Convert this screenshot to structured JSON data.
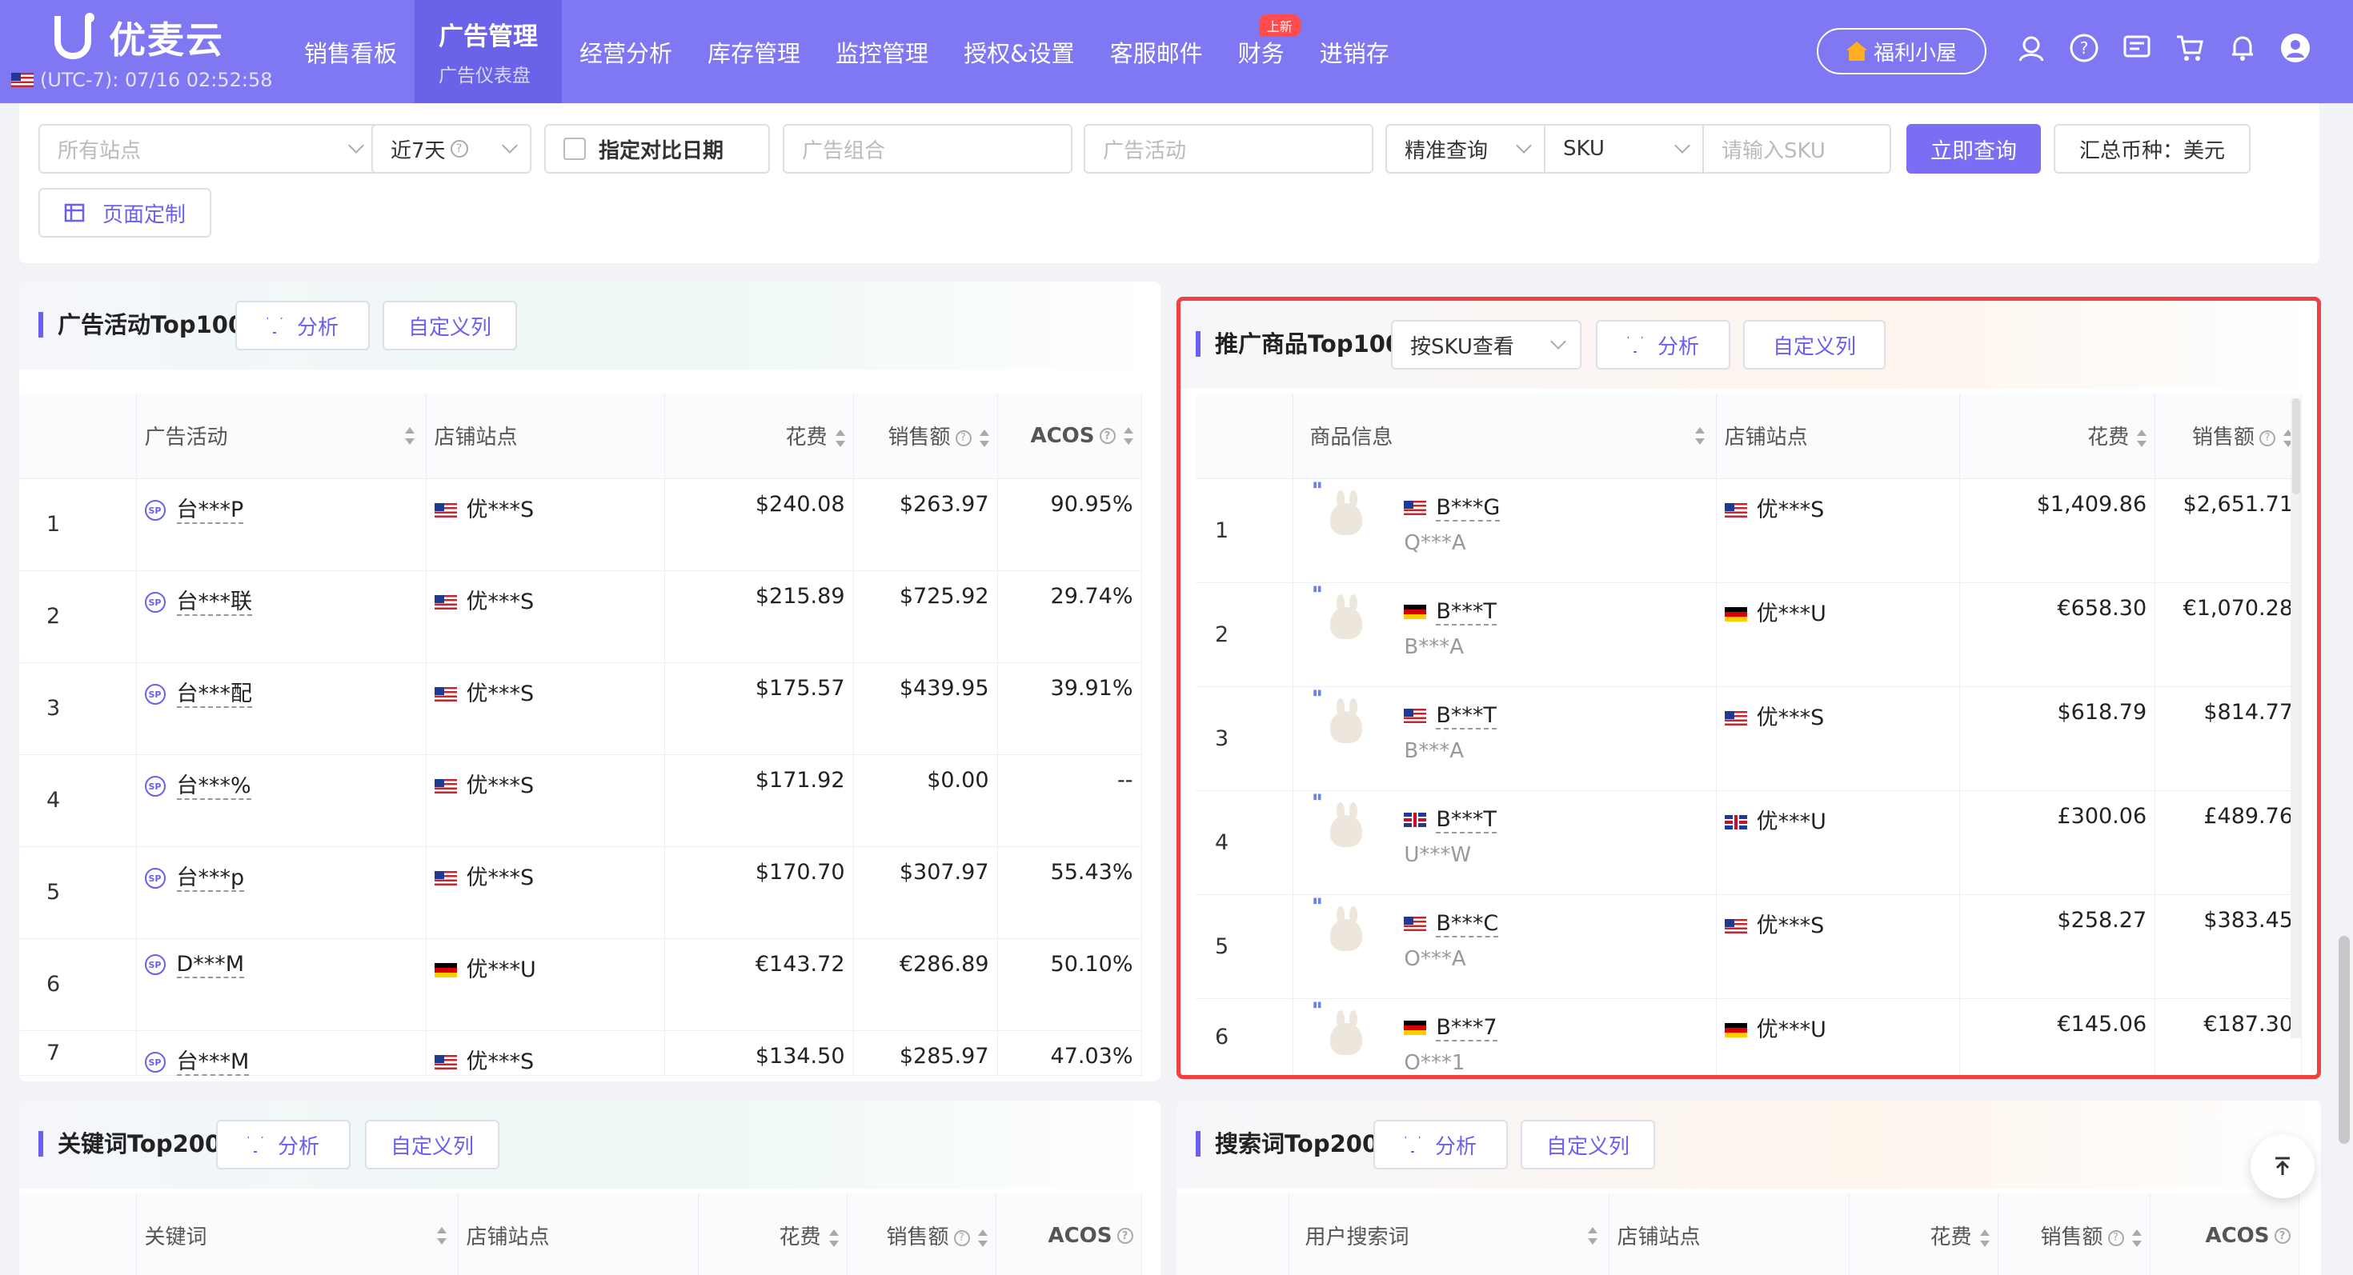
{
  "app": {
    "name": "优麦云",
    "timezone": "(UTC-7): 07/16 02:52:58"
  },
  "nav": [
    {
      "label": "销售看板"
    },
    {
      "label": "广告管理",
      "sub": "广告仪表盘",
      "active": true
    },
    {
      "label": "经营分析"
    },
    {
      "label": "库存管理"
    },
    {
      "label": "监控管理"
    },
    {
      "label": "授权&设置"
    },
    {
      "label": "客服邮件"
    },
    {
      "label": "财务",
      "badge": "上新"
    },
    {
      "label": "进销存"
    }
  ],
  "welfare_label": "福利小屋",
  "filters": {
    "site_placeholder": "所有站点",
    "date_range": "近7天",
    "compare_label": "指定对比日期",
    "group_placeholder": "广告组合",
    "campaign_placeholder": "广告活动",
    "match_type": "精准查询",
    "field": "SKU",
    "sku_placeholder": "请输入SKU",
    "query_button": "立即查询",
    "currency_label": "汇总币种：美元",
    "customize_button": "页面定制"
  },
  "campaign_card": {
    "title": "广告活动Top100",
    "analyze": "分析",
    "custom_cols": "自定义列",
    "columns": [
      "广告活动",
      "店铺站点",
      "花费",
      "销售额",
      "ACOS"
    ],
    "rows": [
      {
        "idx": "1",
        "name": "台***P",
        "flag": "us",
        "store": "优***S",
        "spend": "$240.08",
        "sales": "$263.97",
        "acos": "90.95%"
      },
      {
        "idx": "2",
        "name": "台***联",
        "flag": "us",
        "store": "优***S",
        "spend": "$215.89",
        "sales": "$725.92",
        "acos": "29.74%"
      },
      {
        "idx": "3",
        "name": "台***配",
        "flag": "us",
        "store": "优***S",
        "spend": "$175.57",
        "sales": "$439.95",
        "acos": "39.91%"
      },
      {
        "idx": "4",
        "name": "台***%",
        "flag": "us",
        "store": "优***S",
        "spend": "$171.92",
        "sales": "$0.00",
        "acos": "--"
      },
      {
        "idx": "5",
        "name": "台***p",
        "flag": "us",
        "store": "优***S",
        "spend": "$170.70",
        "sales": "$307.97",
        "acos": "55.43%"
      },
      {
        "idx": "6",
        "name": "D***M",
        "flag": "de",
        "store": "优***U",
        "spend": "€143.72",
        "sales": "€286.89",
        "acos": "50.10%"
      },
      {
        "idx": "7",
        "name": "台***M",
        "flag": "us",
        "store": "优***S",
        "spend": "$134.50",
        "sales": "$285.97",
        "acos": "47.03%"
      }
    ]
  },
  "product_card": {
    "title": "推广商品Top100",
    "view_select": "按SKU查看",
    "analyze": "分析",
    "custom_cols": "自定义列",
    "columns": [
      "商品信息",
      "店铺站点",
      "花费",
      "销售额"
    ],
    "rows": [
      {
        "idx": "1",
        "flag": "us",
        "asin": "B***G",
        "sku": "Q***A",
        "store_flag": "us",
        "store": "优***S",
        "spend": "$1,409.86",
        "sales": "$2,651.71"
      },
      {
        "idx": "2",
        "flag": "de",
        "asin": "B***T",
        "sku": "B***A",
        "store_flag": "de",
        "store": "优***U",
        "spend": "€658.30",
        "sales": "€1,070.28"
      },
      {
        "idx": "3",
        "flag": "us",
        "asin": "B***T",
        "sku": "B***A",
        "store_flag": "us",
        "store": "优***S",
        "spend": "$618.79",
        "sales": "$814.77"
      },
      {
        "idx": "4",
        "flag": "gb",
        "asin": "B***T",
        "sku": "U***W",
        "store_flag": "gb",
        "store": "优***U",
        "spend": "£300.06",
        "sales": "£489.76"
      },
      {
        "idx": "5",
        "flag": "us",
        "asin": "B***C",
        "sku": "O***A",
        "store_flag": "us",
        "store": "优***S",
        "spend": "$258.27",
        "sales": "$383.45"
      },
      {
        "idx": "6",
        "flag": "de",
        "asin": "B***7",
        "sku": "O***1",
        "store_flag": "de",
        "store": "优***U",
        "spend": "€145.06",
        "sales": "€187.30"
      }
    ]
  },
  "keyword_card": {
    "title": "关键词Top200",
    "analyze": "分析",
    "custom_cols": "自定义列",
    "columns": [
      "关键词",
      "店铺站点",
      "花费",
      "销售额",
      "ACOS"
    ]
  },
  "search_card": {
    "title": "搜索词Top200",
    "analyze": "分析",
    "custom_cols": "自定义列",
    "columns": [
      "用户搜索词",
      "店铺站点",
      "花费",
      "销售额",
      "ACOS"
    ]
  }
}
